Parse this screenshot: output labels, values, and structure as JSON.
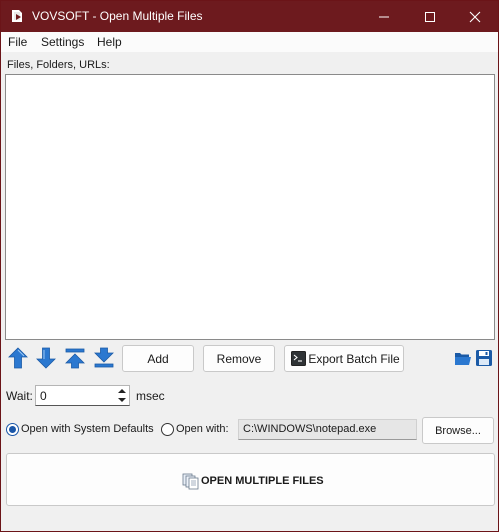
{
  "window": {
    "title": "VOVSOFT - Open Multiple Files"
  },
  "menu": {
    "file": "File",
    "settings": "Settings",
    "help": "Help"
  },
  "files": {
    "label": "Files, Folders, URLs:",
    "items": []
  },
  "toolbar": {
    "add_label": "Add",
    "remove_label": "Remove",
    "export_label": "Export Batch File"
  },
  "wait": {
    "label": "Wait:",
    "value": "0",
    "unit": "msec"
  },
  "open_mode": {
    "system_defaults_label": "Open with System Defaults",
    "open_with_label": "Open with:",
    "selected": "system_defaults",
    "program_path": "C:\\WINDOWS\\notepad.exe",
    "browse_label": "Browse..."
  },
  "action": {
    "open_label": "OPEN MULTIPLE FILES"
  },
  "colors": {
    "titlebar": "#6d1a1e",
    "arrow_blue": "#2b78d0",
    "radio_accent": "#1a56a8"
  }
}
